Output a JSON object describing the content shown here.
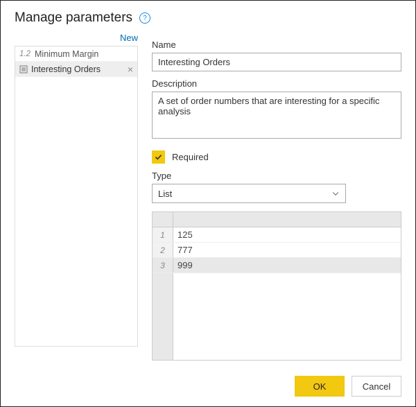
{
  "title": "Manage parameters",
  "new_label": "New",
  "sidebar": {
    "items": [
      {
        "prefix": "1.2",
        "label": "Minimum Margin",
        "selected": false,
        "icon": null
      },
      {
        "prefix": "",
        "label": "Interesting Orders",
        "selected": true,
        "icon": "list"
      }
    ]
  },
  "form": {
    "name_label": "Name",
    "name_value": "Interesting Orders",
    "desc_label": "Description",
    "desc_value": "A set of order numbers that are interesting for a specific analysis",
    "required_label": "Required",
    "required_checked": true,
    "type_label": "Type",
    "type_value": "List"
  },
  "grid": {
    "rows": [
      {
        "i": "1",
        "v": "125"
      },
      {
        "i": "2",
        "v": "777"
      },
      {
        "i": "3",
        "v": "999"
      }
    ],
    "selected_index": 2
  },
  "footer": {
    "ok": "OK",
    "cancel": "Cancel"
  }
}
